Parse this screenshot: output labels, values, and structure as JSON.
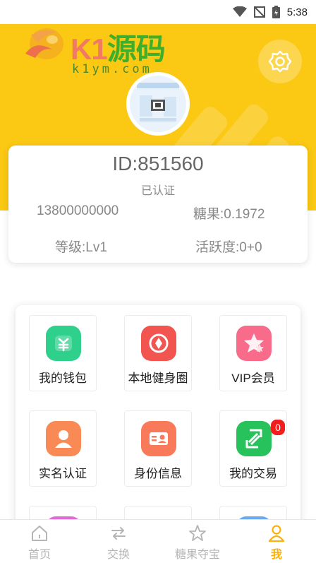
{
  "status_bar": {
    "time": "5:38"
  },
  "logo": {
    "brand_k": "K1",
    "brand_cn": "源码",
    "domain": "k1ym.com"
  },
  "profile": {
    "id_text": "ID:851560",
    "verified": "已认证",
    "phone": "13800000000",
    "candy": "糖果:0.1972",
    "level": "等级:Lv1",
    "activity": "活跃度:0+0"
  },
  "menu": [
    {
      "label": "我的钱包",
      "icon": "wallet-icon",
      "color": "#2fcf8c"
    },
    {
      "label": "本地健身圈",
      "icon": "red-packet-icon",
      "color": "#f2554f"
    },
    {
      "label": "VIP会员",
      "icon": "star-icon",
      "color": "#f96b8a"
    },
    {
      "label": "实名认证",
      "icon": "user-icon",
      "color": "#f98a55"
    },
    {
      "label": "身份信息",
      "icon": "id-card-icon",
      "color": "#f87a5a"
    },
    {
      "label": "我的交易",
      "icon": "exchange-icon",
      "color": "#27c25c",
      "badge": "0"
    }
  ],
  "nav": [
    {
      "label": "首页",
      "icon": "home-icon"
    },
    {
      "label": "交换",
      "icon": "swap-icon"
    },
    {
      "label": "糖果夺宝",
      "icon": "star-outline-icon"
    },
    {
      "label": "我",
      "icon": "person-icon",
      "active": true
    }
  ],
  "colors": {
    "primary": "#fbc813",
    "accent": "#fbb30b",
    "badge": "#f41d1d"
  }
}
